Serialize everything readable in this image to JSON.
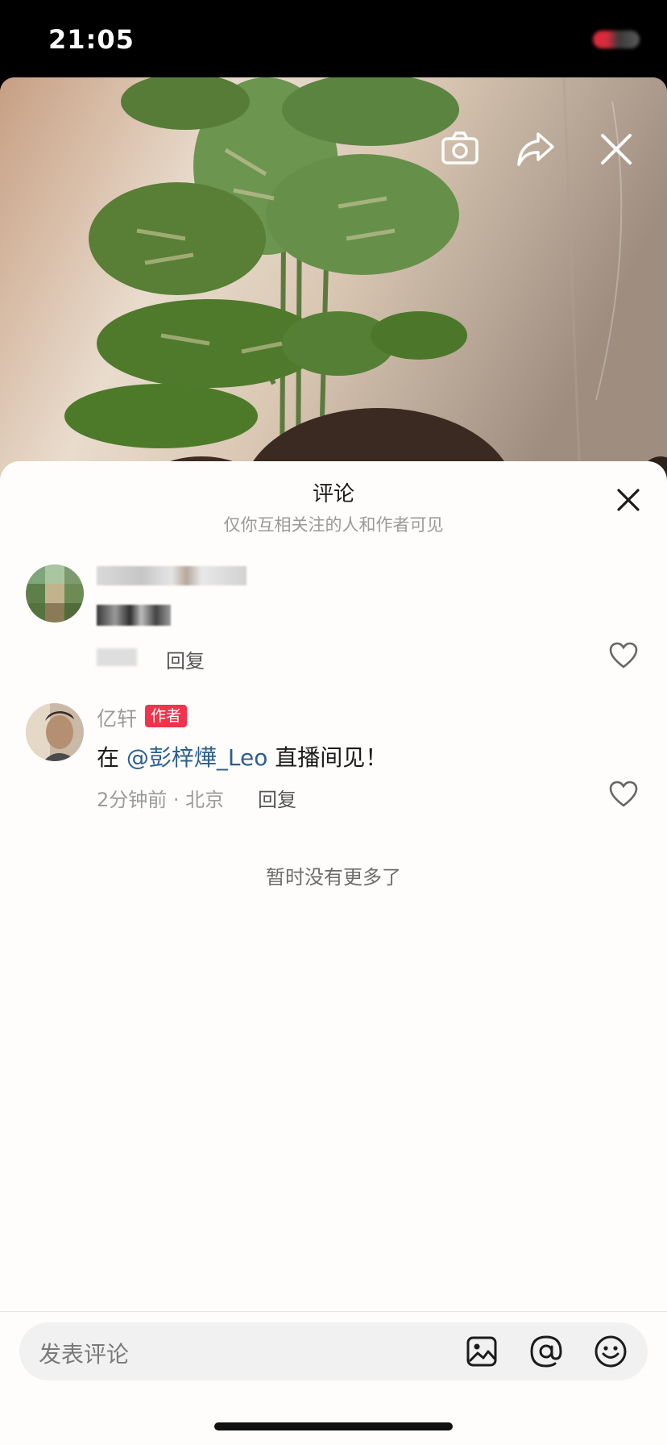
{
  "status_bar": {
    "time": "21:05"
  },
  "photo": {
    "icons": [
      "camera-icon",
      "share-icon",
      "close-icon"
    ]
  },
  "comments_panel": {
    "title": "评论",
    "subtitle": "仅你互相关注的人和作者可见",
    "comments": [
      {
        "author": "",
        "text": "",
        "time": "",
        "reply": "回复",
        "obscured": true
      },
      {
        "author": "亿轩",
        "badge": "作者",
        "text_prefix": "在 ",
        "mention": "@彭梓燁_Leo",
        "text_suffix": " 直播间见！",
        "time": "2分钟前 · 北京",
        "reply": "回复"
      }
    ],
    "no_more": "暂时没有更多了"
  },
  "input": {
    "placeholder": "发表评论",
    "icons": [
      "image-icon",
      "at-icon",
      "emoji-icon"
    ]
  },
  "colors": {
    "accent_badge": "#f2334c",
    "mention": "#2e5e8f"
  }
}
